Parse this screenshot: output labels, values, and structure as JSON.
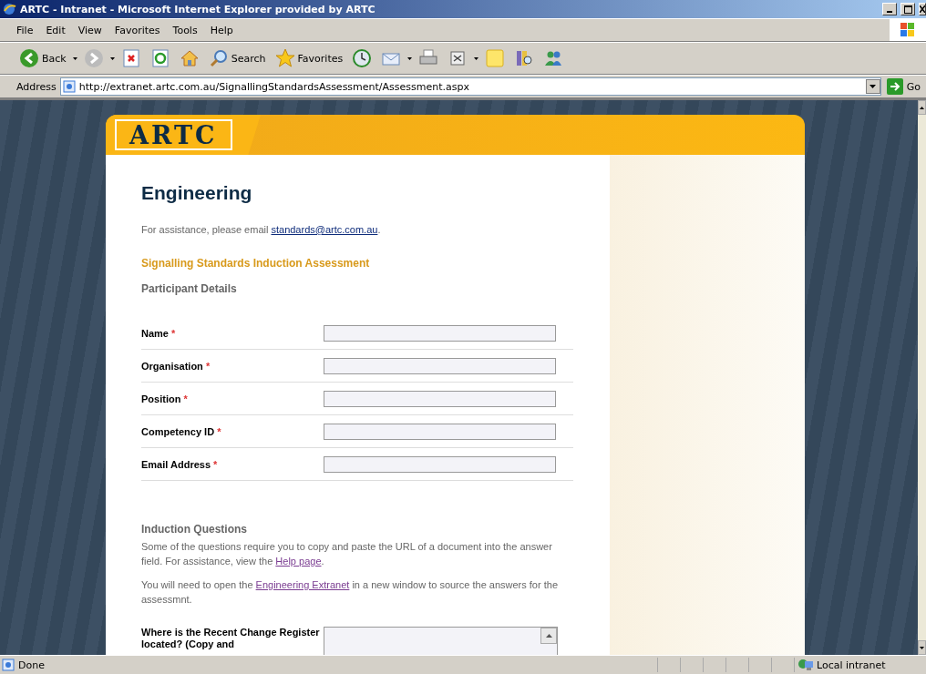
{
  "window": {
    "title": "ARTC - Intranet - Microsoft Internet Explorer provided by ARTC"
  },
  "menu": [
    "File",
    "Edit",
    "View",
    "Favorites",
    "Tools",
    "Help"
  ],
  "toolbar": [
    {
      "kind": "back",
      "label": "Back"
    },
    {
      "kind": "forward"
    },
    {
      "kind": "stop"
    },
    {
      "kind": "refresh"
    },
    {
      "kind": "home"
    },
    {
      "kind": "search",
      "label": "Search"
    },
    {
      "kind": "favorites",
      "label": "Favorites"
    },
    {
      "kind": "history"
    },
    {
      "kind": "mail"
    },
    {
      "kind": "print"
    },
    {
      "kind": "edit"
    },
    {
      "kind": "note"
    },
    {
      "kind": "research"
    },
    {
      "kind": "messenger"
    }
  ],
  "address": {
    "label": "Address",
    "url": "http://extranet.artc.com.au/SignallingStandardsAssessment/Assessment.aspx",
    "go": "Go"
  },
  "page": {
    "logo": "ARTC",
    "heading": "Engineering",
    "assist": {
      "before": "For assistance, please email ",
      "link": "standards@artc.com.au",
      "after": "."
    },
    "section_title": "Signalling Standards Induction Assessment",
    "participant_heading": "Participant Details",
    "fields": [
      {
        "label": "Name",
        "required": "*"
      },
      {
        "label": "Organisation",
        "required": "*"
      },
      {
        "label": "Position",
        "required": "*"
      },
      {
        "label": "Competency ID",
        "required": "*"
      },
      {
        "label": "Email Address",
        "required": "*"
      }
    ],
    "induction_heading": "Induction Questions",
    "paragraphs": [
      {
        "before": "Some of the questions require you to copy and paste the URL of a document into the answer field. For assistance, view the ",
        "link": "Help page",
        "after": "."
      },
      {
        "before": "You will need to open the ",
        "link": "Engineering Extranet",
        "after": " in a new window to source the answers for the assessmnt."
      }
    ],
    "question": "Where is the Recent Change Register located? (Copy and"
  },
  "status_bar": {
    "text": "Done",
    "zone": "Local intranet"
  }
}
